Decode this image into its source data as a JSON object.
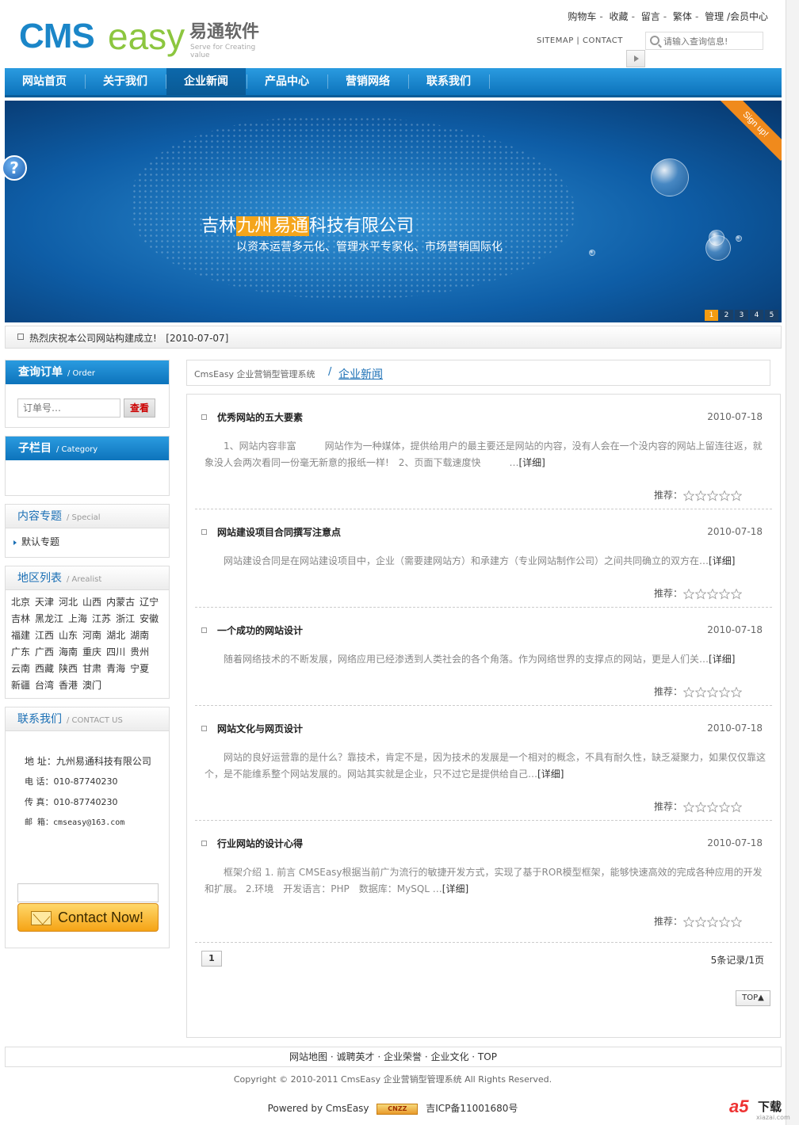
{
  "header": {
    "logo": {
      "cms": "CMS",
      "easy": "easy",
      "cn": "易通软件",
      "en": "Serve for Creating value"
    },
    "toplinks": [
      "购物车",
      "收藏",
      "留言",
      "繁体",
      "管理",
      "/会员中心"
    ],
    "sitemap": "SITEMAP",
    "contact": "CONTACT",
    "search_placeholder": "请输入查询信息!"
  },
  "nav": {
    "items": [
      "网站首页",
      "关于我们",
      "企业新闻",
      "产品中心",
      "营销网络",
      "联系我们"
    ],
    "active_index": 2
  },
  "banner": {
    "title_pre": "吉林",
    "title_hl1": "九州",
    "title_hl2": "易通",
    "title_post": "科技有限公司",
    "subtitle": "以资本运营多元化、管理水平专家化、市场营销国际化",
    "ribbon": "Sign up!",
    "pager": [
      "1",
      "2",
      "3",
      "4",
      "5"
    ],
    "help": "?"
  },
  "ticker": {
    "text": "热烈庆祝本公司网站构建成立!",
    "date": "[2010-07-07]"
  },
  "sidebar": {
    "order": {
      "title": "查询订单",
      "sub": "/ Order",
      "placeholder": "订单号…",
      "button": "查看"
    },
    "category": {
      "title": "子栏目",
      "sub": "/ Category"
    },
    "special": {
      "title": "内容专题",
      "sub": "/ Special",
      "item": "默认专题"
    },
    "regions": {
      "title": "地区列表",
      "sub": "/ Arealist",
      "items": [
        "北京",
        "天津",
        "河北",
        "山西",
        "内蒙古",
        "辽宁",
        "吉林",
        "黑龙江",
        "上海",
        "江苏",
        "浙江",
        "安徽",
        "福建",
        "江西",
        "山东",
        "河南",
        "湖北",
        "湖南",
        "广东",
        "广西",
        "海南",
        "重庆",
        "四川",
        "贵州",
        "云南",
        "西藏",
        "陕西",
        "甘肃",
        "青海",
        "宁夏",
        "新疆",
        "台湾",
        "香港",
        "澳门"
      ]
    },
    "contact": {
      "title": "联系我们",
      "sub": "/ CONTACT US",
      "address": "地  址：九州易通科技有限公司",
      "phone": "电  话：010-87740230",
      "fax": "传  真：010-87740230",
      "email": "邮  箱：cmseasy@163.com",
      "button": "Contact Now!"
    }
  },
  "breadcrumb": {
    "site": "CmsEasy 企业营销型管理系统",
    "current": "企业新闻"
  },
  "articles": [
    {
      "title": "优秀网站的五大要素",
      "date": "2010-07-18",
      "summary": "1、网站内容非富　　　网站作为一种媒体，提供给用户的最主要还是网站的内容，没有人会在一个没内容的网站上留连往返，就象没人会两次看同一份毫无新意的报纸一样!　2、页面下载速度快　　　…",
      "more": "[详细]",
      "rec": "推荐："
    },
    {
      "title": "网站建设项目合同撰写注意点",
      "date": "2010-07-18",
      "summary": "网站建设合同是在网站建设项目中，企业（需要建网站方）和承建方（专业网站制作公司）之间共同确立的双方在…",
      "more": "[详细]",
      "rec": "推荐："
    },
    {
      "title": "一个成功的网站设计",
      "date": "2010-07-18",
      "summary": "随着网络技术的不断发展，网络应用已经渗透到人类社会的各个角落。作为网络世界的支撑点的网站，更是人们关…",
      "more": "[详细]",
      "rec": "推荐："
    },
    {
      "title": "网站文化与网页设计",
      "date": "2010-07-18",
      "summary": "网站的良好运营靠的是什么？靠技术，肯定不是，因为技术的发展是一个相对的概念，不具有耐久性，缺乏凝聚力，如果仅仅靠这个，是不能维系整个网站发展的。网站其实就是企业，只不过它是提供给自己…",
      "more": "[详细]",
      "rec": "推荐："
    },
    {
      "title": "行业网站的设计心得",
      "date": "2010-07-18",
      "summary": "框架介绍 1. 前言 CMSEasy根据当前广为流行的敏捷开发方式，实现了基于ROR模型框架，能够快速高效的完成各种应用的开发和扩展。 2.环境　开发语言：PHP　数据库：MySQL …",
      "more": "[详细]",
      "rec": "推荐："
    }
  ],
  "pager": {
    "page": "1",
    "info": "5条记录/1页",
    "top": "TOP▲"
  },
  "footer": {
    "links": [
      "网站地图",
      "诚聘英才",
      "企业荣誉",
      "企业文化",
      "TOP"
    ],
    "copyright": "Copyright © 2010-2011 CmsEasy 企业营销型管理系统  All Rights Reserved.",
    "powered": "Powered by CmsEasy",
    "cnzz": "CNZZ",
    "icp": "吉ICP备11001680号"
  },
  "watermark": {
    "a5": "a5",
    "dl": "下载",
    "site": "xiazai.com"
  },
  "colors": {
    "nav_blue": "#1b86c8",
    "accent_orange": "#f39c12",
    "link_blue": "#1a6fb5"
  }
}
